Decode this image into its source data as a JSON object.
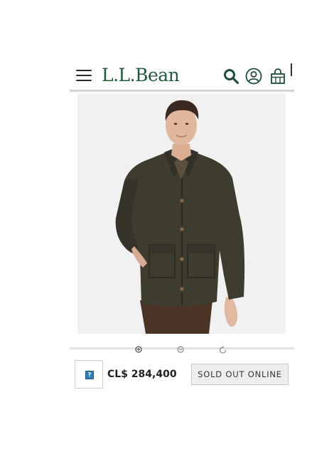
{
  "header": {
    "logo_text": "L.L.Bean",
    "brand_color": "#1f5a39",
    "icons": [
      "menu-icon",
      "search-icon",
      "account-icon",
      "shopping-bag-icon"
    ]
  },
  "product": {
    "image_alt": "Man wearing dark olive waxed field jacket",
    "viewer_icons": [
      "zoom-in-icon",
      "zoom-out-icon",
      "rotate-icon"
    ]
  },
  "purchase_bar": {
    "thumbnail_icon": "missing-image-icon",
    "price": "CL$ 284,400",
    "status_button": "SOLD OUT ONLINE"
  }
}
